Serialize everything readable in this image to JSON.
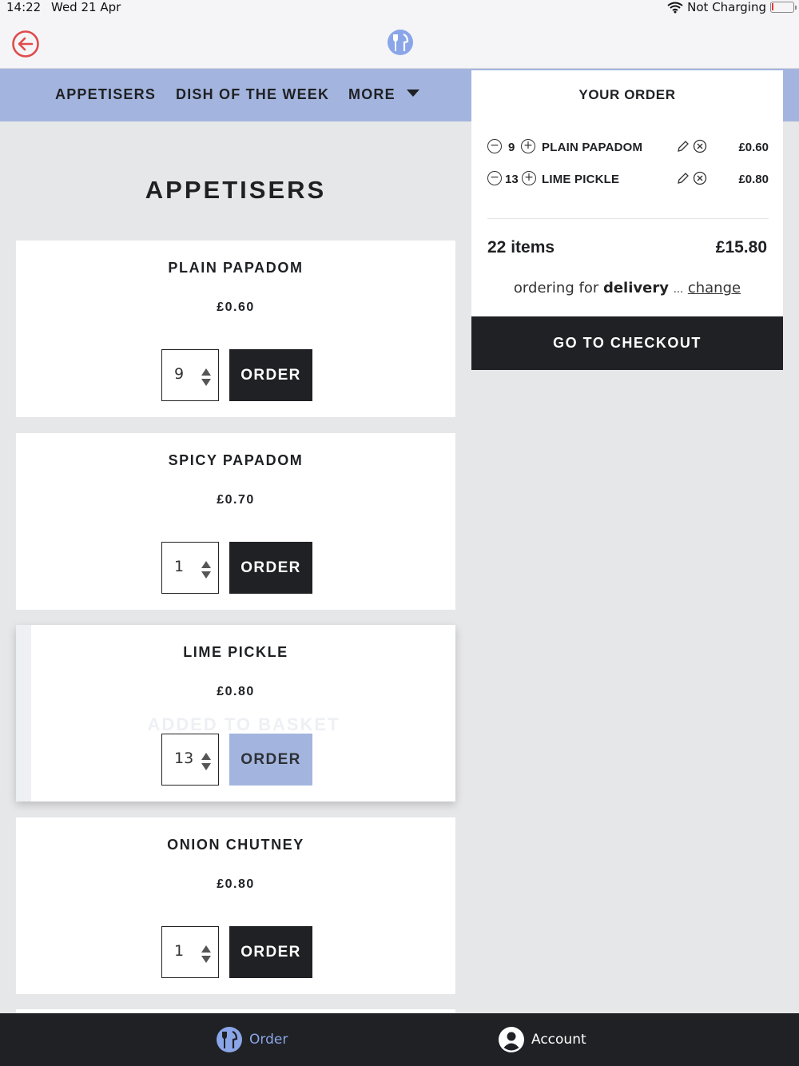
{
  "status_bar": {
    "time": "14:22",
    "date": "Wed 21 Apr",
    "charging": "Not Charging"
  },
  "top_bar": {
    "back_icon": "back-arrow-circle-icon",
    "logo_icon": "restaurant-logo-icon"
  },
  "category_nav": {
    "items": [
      "APPETISERS",
      "DISH OF THE WEEK",
      "MORE"
    ]
  },
  "section": {
    "title": "APPETISERS"
  },
  "products": [
    {
      "name": "PLAIN PAPADOM",
      "price": "£0.60",
      "qty": "9",
      "order_label": "ORDER"
    },
    {
      "name": "SPICY PAPADOM",
      "price": "£0.70",
      "qty": "1",
      "order_label": "ORDER"
    },
    {
      "name": "LIME PICKLE",
      "price": "£0.80",
      "qty": "13",
      "order_label": "ORDER",
      "added_message": "ADDED TO BASKET"
    },
    {
      "name": "ONION CHUTNEY",
      "price": "£0.80",
      "qty": "1",
      "order_label": "ORDER"
    }
  ],
  "order_panel": {
    "title": "YOUR ORDER",
    "lines": [
      {
        "qty": "9",
        "name": "PLAIN PAPADOM",
        "price": "£0.60"
      },
      {
        "qty": "13",
        "name": "LIME PICKLE",
        "price": "£0.80"
      }
    ],
    "items_count": "22 items",
    "total": "£15.80",
    "mode_prefix": "ordering for",
    "mode": "delivery",
    "mode_sep": "...",
    "change_label": "change",
    "checkout_label": "GO TO CHECKOUT"
  },
  "tab_bar": {
    "order_label": "Order",
    "account_label": "Account"
  },
  "colors": {
    "accent": "#a3b5de",
    "dark": "#202124",
    "back_icon": "#e04b4b",
    "tab_active": "#8aa6e8",
    "background": "#e6e7e9"
  }
}
